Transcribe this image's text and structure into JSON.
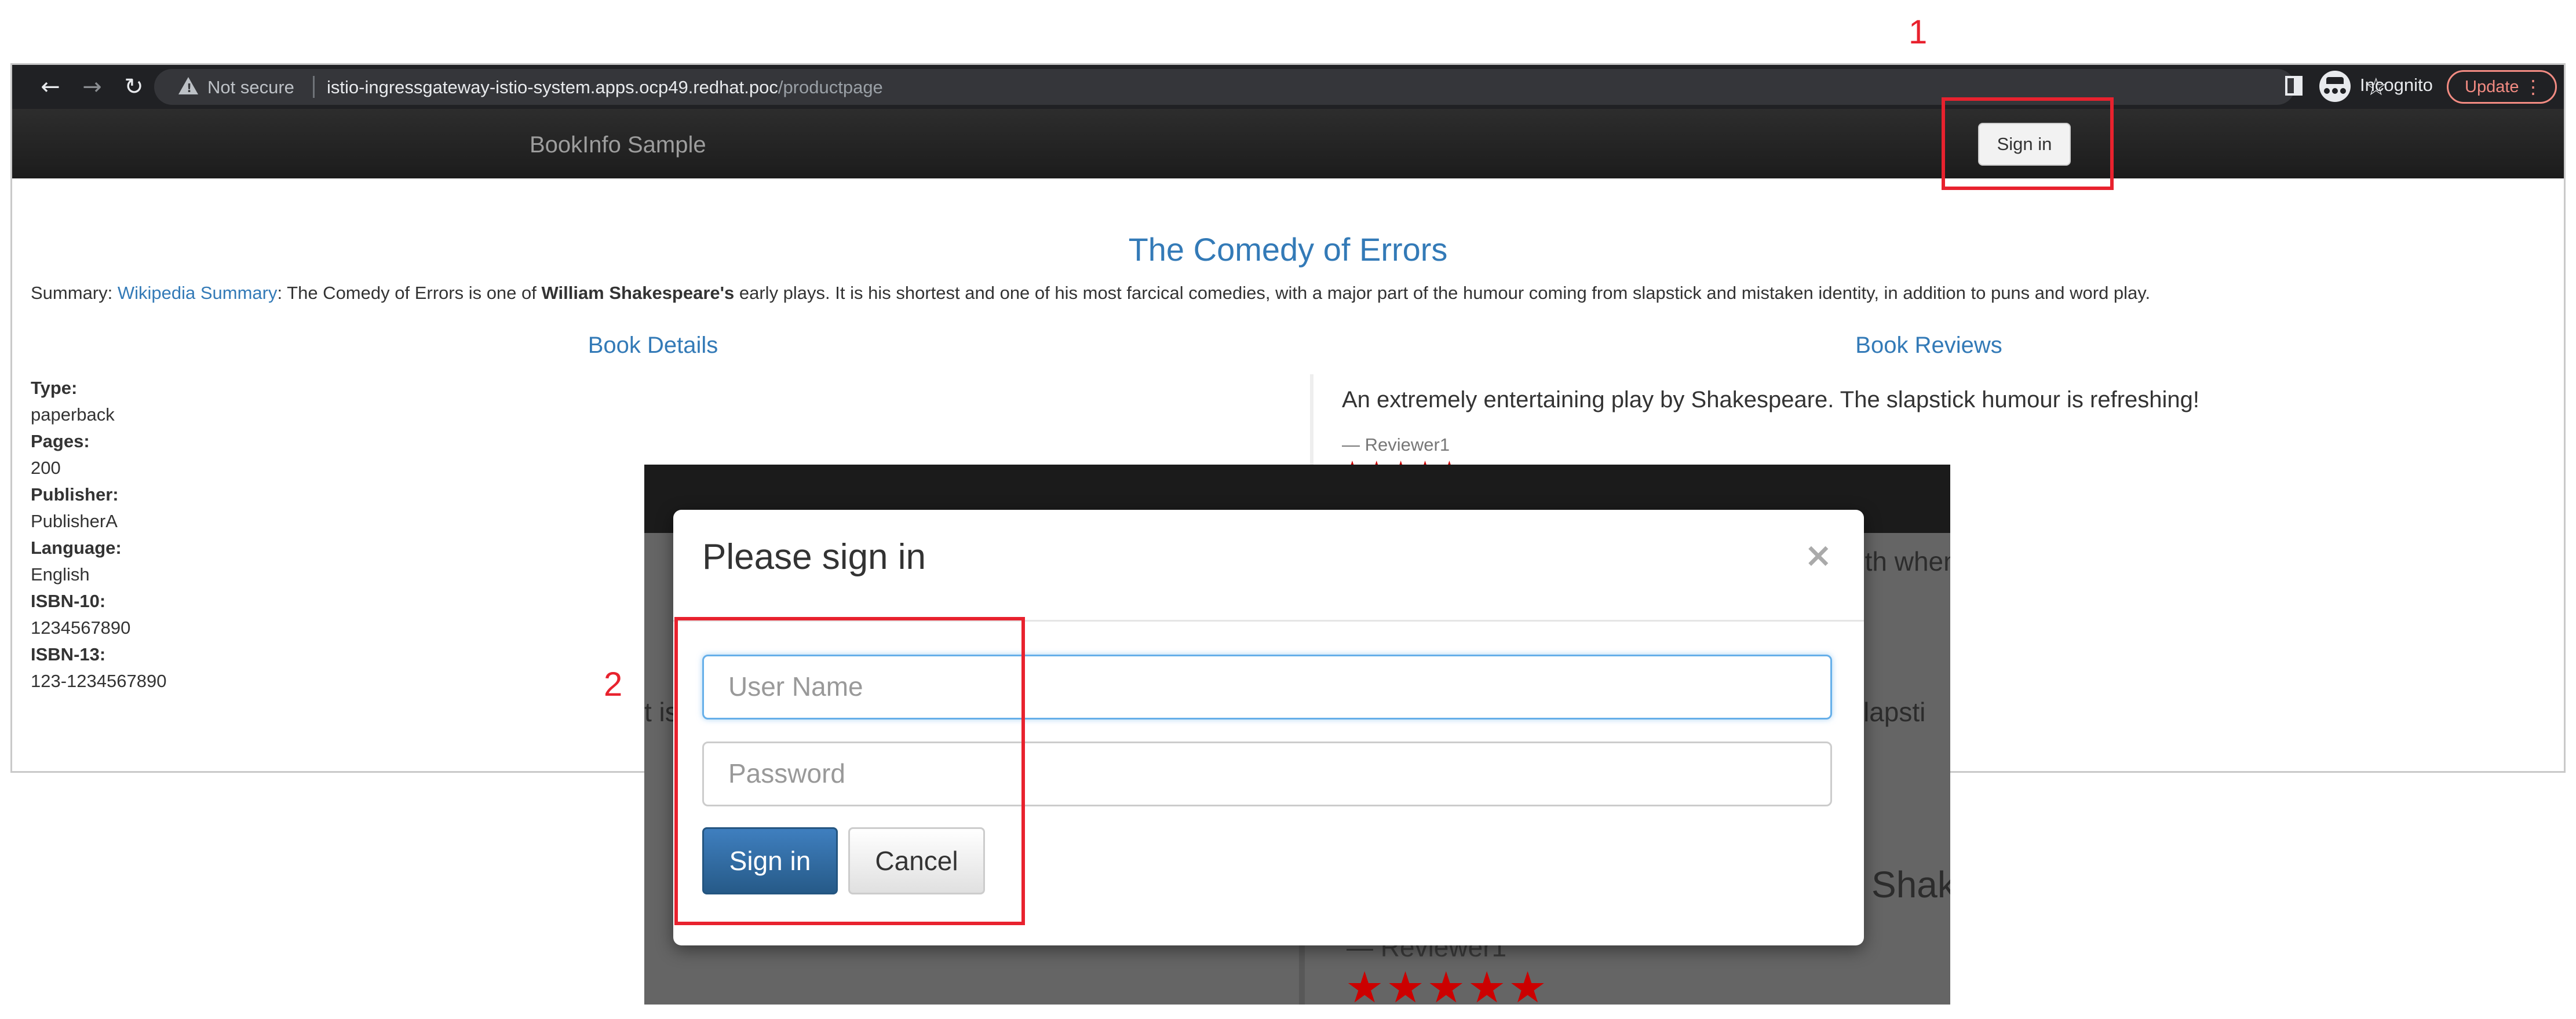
{
  "browser": {
    "security_label": "Not secure",
    "url_host": "istio-ingressgateway-istio-system.apps.ocp49.redhat.poc",
    "url_path": "/productpage",
    "incognito_label": "Incognito",
    "update_label": "Update"
  },
  "navbar": {
    "brand": "BookInfo Sample",
    "signin_label": "Sign in"
  },
  "book": {
    "title": "The Comedy of Errors",
    "summary_prefix": "Summary: ",
    "summary_link": "Wikipedia Summary",
    "summary_part1": ": The Comedy of Errors is one of ",
    "summary_bold": "William Shakespeare's",
    "summary_part2": " early plays. It is his shortest and one of his most farcical comedies, with a major part of the humour coming from slapstick and mistaken identity, in addition to puns and word play."
  },
  "details": {
    "heading": "Book Details",
    "type_label": "Type:",
    "type_value": "paperback",
    "pages_label": "Pages:",
    "pages_value": "200",
    "publisher_label": "Publisher:",
    "publisher_value": "PublisherA",
    "language_label": "Language:",
    "language_value": "English",
    "isbn10_label": "ISBN-10:",
    "isbn10_value": "1234567890",
    "isbn13_label": "ISBN-13:",
    "isbn13_value": "123-1234567890"
  },
  "reviews": {
    "heading": "Book Reviews",
    "review1_text": "An extremely entertaining play by Shakespeare. The slapstick humour is refreshing!",
    "review1_author": "— Reviewer1",
    "review1_stars": "★★★★★",
    "review1_rating": 5,
    "partial_text_right": "pth when compared to other plays by Shakespeare.",
    "partial_text_mid": "slapsti",
    "partial_text_left": "t is",
    "partial_text_shak": "Shak",
    "zoom_reviewer": "— Reviewer1",
    "zoom_stars": "★★★★★"
  },
  "modal": {
    "title": "Please sign in",
    "close_glyph": "×",
    "username_placeholder": "User Name",
    "password_placeholder": "Password",
    "signin_label": "Sign in",
    "cancel_label": "Cancel"
  },
  "annotations": {
    "label_1": "1",
    "label_2": "2"
  },
  "colors": {
    "link": "#337ab7",
    "annotation": "#e8222e",
    "star": "#cc0000",
    "primary_button": "#286090"
  }
}
